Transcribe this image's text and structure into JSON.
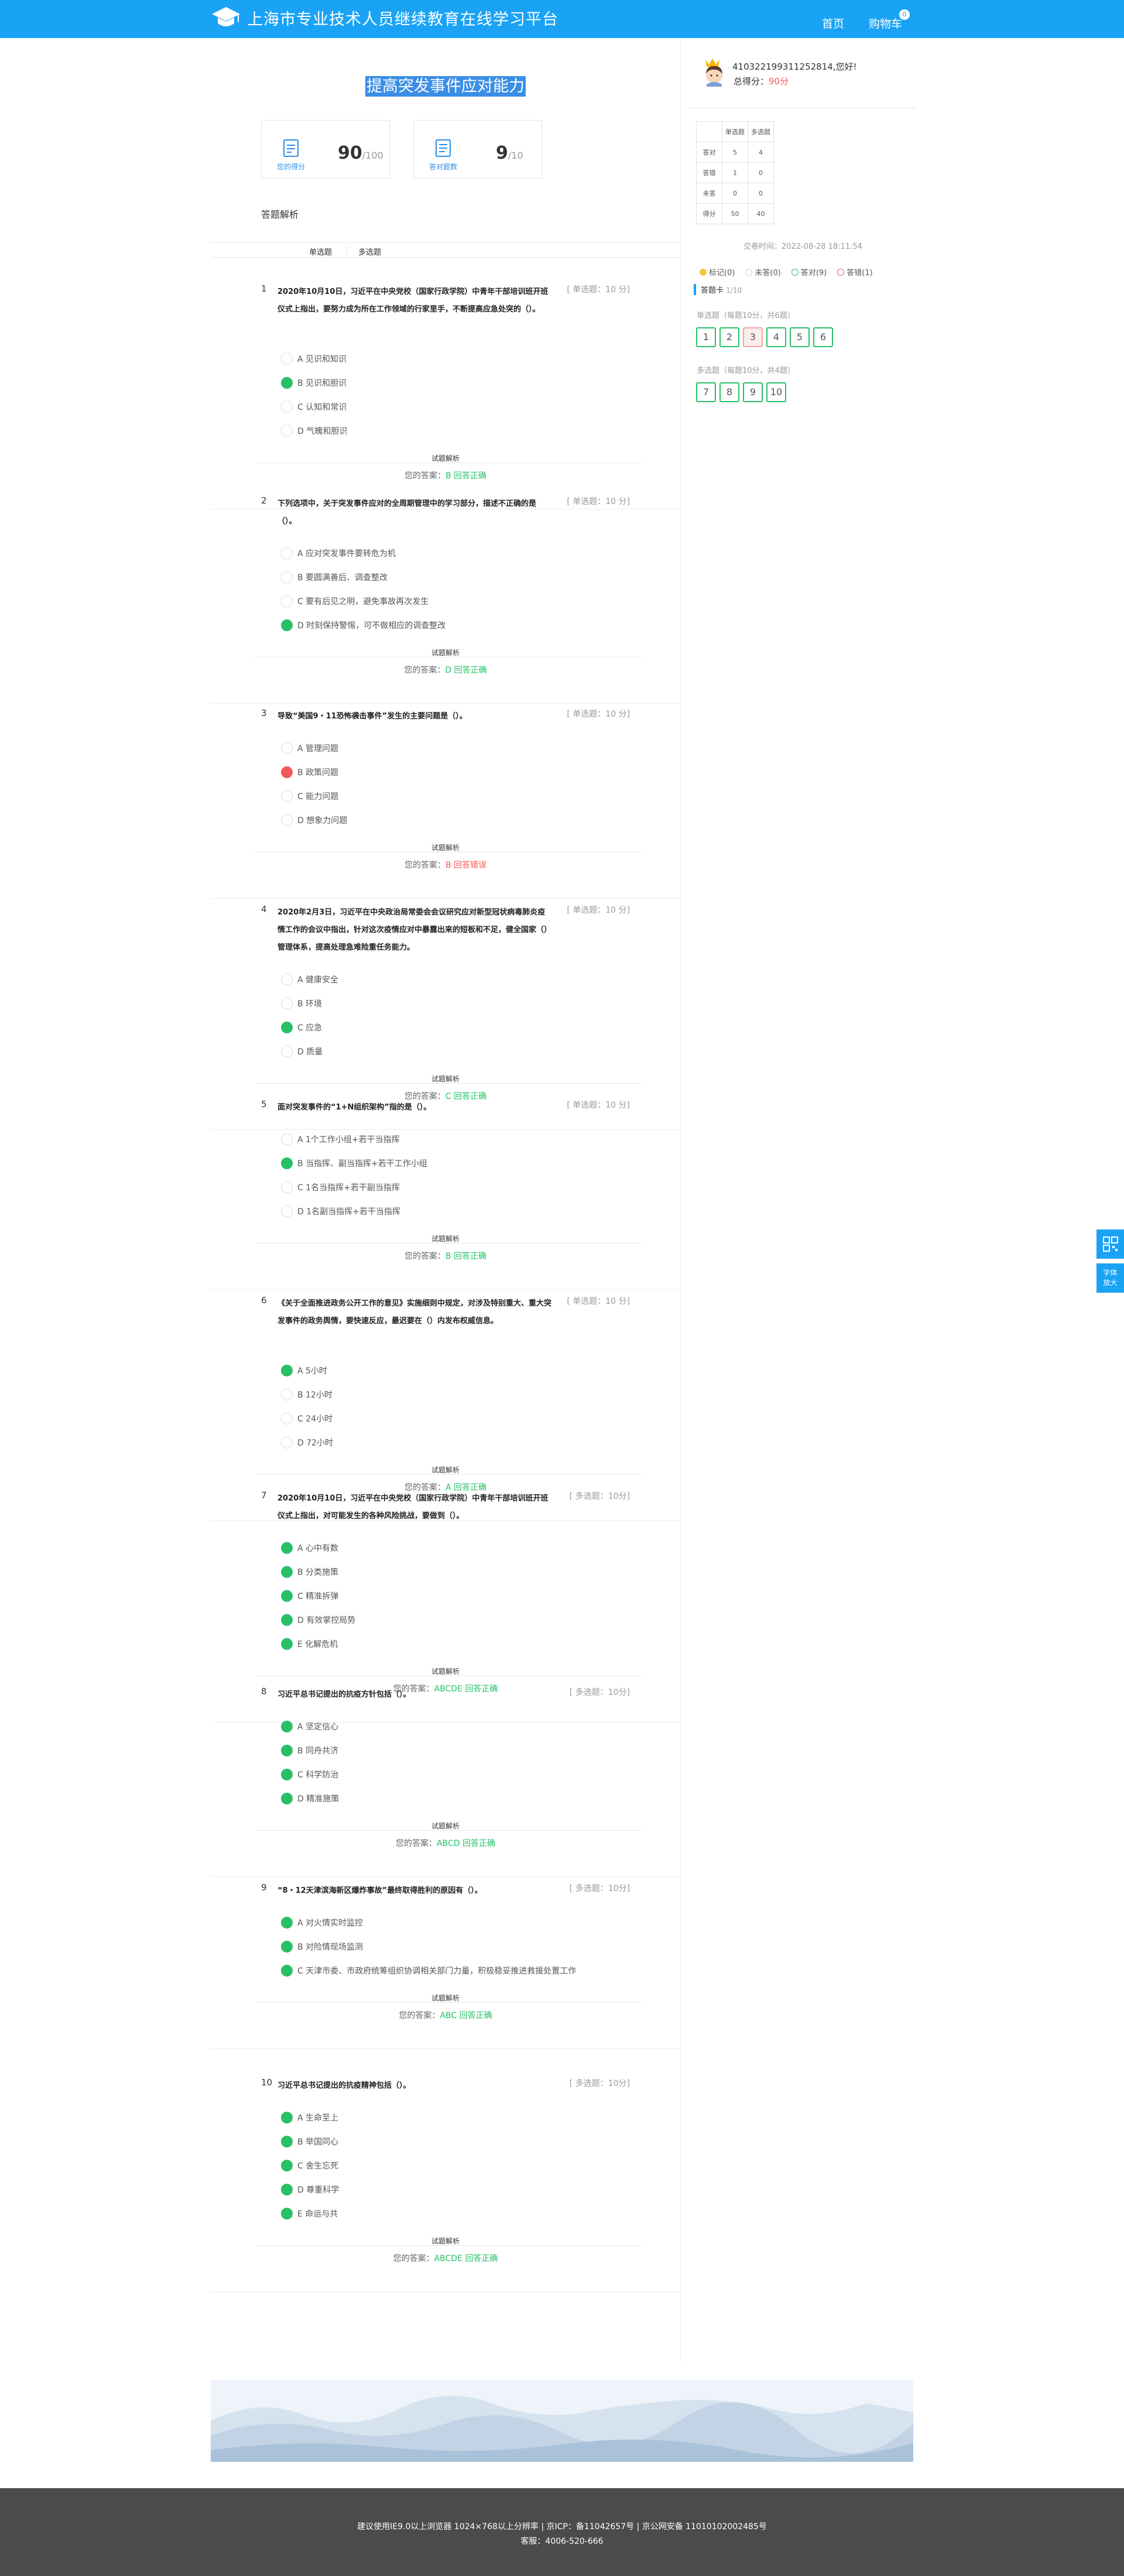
{
  "header": {
    "site_title": "上海市专业技术人员继续教育在线学习平台",
    "nav_home": "首页",
    "nav_cart": "购物车",
    "cart_count": "0"
  },
  "exam": {
    "title": "提高突发事件应对能力",
    "my_score_label": "您的得分",
    "my_score": "90",
    "my_score_total": "/100",
    "correct_label": "答对题数",
    "correct_count": "9",
    "correct_total": "/10",
    "analysis_title": "答题解析",
    "tab_single": "单选题",
    "tab_multi": "多选题"
  },
  "questions": [
    {
      "num": "1",
      "text": "2020年10月10日，习近平在中央党校（国家行政学院）中青年干部培训班开班仪式上指出，要努力成为所在工作领域的行家里手，不断提高应急处突的（）。",
      "meta": "[ 单选题：10 分]",
      "options": [
        {
          "label": "A 见识和知识",
          "state": "none"
        },
        {
          "label": "B 见识和胆识",
          "state": "correct"
        },
        {
          "label": "C 认知和常识",
          "state": "none"
        },
        {
          "label": "D 气魄和胆识",
          "state": "none"
        }
      ],
      "expl": "试题解析",
      "answer_prefix": "您的答案：",
      "answer": "B",
      "result": "回答正确",
      "ok": true
    },
    {
      "num": "2",
      "text": "下列选项中，关于突发事件应对的全周期管理中的学习部分，描述不正确的是（）。",
      "meta": "[ 单选题：10 分]",
      "options": [
        {
          "label": "A 应对突发事件要转危为机",
          "state": "none"
        },
        {
          "label": "B 要圆满善后、调查整改",
          "state": "none"
        },
        {
          "label": "C 要有后见之明，避免事故再次发生",
          "state": "none"
        },
        {
          "label": "D 时刻保持警惕，可不做相应的调查整改",
          "state": "correct"
        }
      ],
      "expl": "试题解析",
      "answer_prefix": "您的答案：",
      "answer": "D",
      "result": "回答正确",
      "ok": true
    },
    {
      "num": "3",
      "text": "导致“美国9・11恐怖袭击事件”发生的主要问题是（）。",
      "meta": "[ 单选题：10 分]",
      "options": [
        {
          "label": "A 管理问题",
          "state": "none"
        },
        {
          "label": "B 政策问题",
          "state": "wrong"
        },
        {
          "label": "C 能力问题",
          "state": "none"
        },
        {
          "label": "D 想象力问题",
          "state": "none"
        }
      ],
      "expl": "试题解析",
      "answer_prefix": "您的答案：",
      "answer": "B",
      "result": "回答错误",
      "ok": false
    },
    {
      "num": "4",
      "text": "2020年2月3日，习近平在中央政治局常委会会议研究应对新型冠状病毒肺炎疫情工作的会议中指出，针对这次疫情应对中暴露出来的短板和不足，健全国家（）管理体系，提高处理急难险重任务能力。",
      "meta": "[ 单选题：10 分]",
      "options": [
        {
          "label": "A 健康安全",
          "state": "none"
        },
        {
          "label": "B 环境",
          "state": "none"
        },
        {
          "label": "C 应急",
          "state": "correct"
        },
        {
          "label": "D 质量",
          "state": "none"
        }
      ],
      "expl": "试题解析",
      "answer_prefix": "您的答案：",
      "answer": "C",
      "result": "回答正确",
      "ok": true
    },
    {
      "num": "5",
      "text": "面对突发事件的“1+N组织架构”指的是（）。",
      "meta": "[ 单选题：10 分]",
      "options": [
        {
          "label": "A 1个工作小组+若干当指挥",
          "state": "none"
        },
        {
          "label": "B 当指挥、副当指挥+若干工作小组",
          "state": "correct"
        },
        {
          "label": "C 1名当指挥+若干副当指挥",
          "state": "none"
        },
        {
          "label": "D 1名副当指挥+若干当指挥",
          "state": "none"
        }
      ],
      "expl": "试题解析",
      "answer_prefix": "您的答案：",
      "answer": "B",
      "result": "回答正确",
      "ok": true
    },
    {
      "num": "6",
      "text": "《关于全面推进政务公开工作的意见》实施细则中规定，对涉及特别重大、重大突发事件的政务舆情，要快速反应，最迟要在（）内发布权威信息。",
      "meta": "[ 单选题：10 分]",
      "options": [
        {
          "label": "A 5小时",
          "state": "correct"
        },
        {
          "label": "B 12小时",
          "state": "none"
        },
        {
          "label": "C 24小时",
          "state": "none"
        },
        {
          "label": "D 72小时",
          "state": "none"
        }
      ],
      "expl": "试题解析",
      "answer_prefix": "您的答案：",
      "answer": "A",
      "result": "回答正确",
      "ok": true
    },
    {
      "num": "7",
      "text": "2020年10月10日，习近平在中央党校（国家行政学院）中青年干部培训班开班仪式上指出，对可能发生的各种风险挑战，要做到（）。",
      "meta": "[ 多选题：10分]",
      "options": [
        {
          "label": "A 心中有数",
          "state": "correct"
        },
        {
          "label": "B 分类施策",
          "state": "correct"
        },
        {
          "label": "C 精准拆弹",
          "state": "correct"
        },
        {
          "label": "D 有效掌控局势",
          "state": "correct"
        },
        {
          "label": "E 化解危机",
          "state": "correct"
        }
      ],
      "expl": "试题解析",
      "answer_prefix": "您的答案：",
      "answer": "ABCDE",
      "result": "回答正确",
      "ok": true
    },
    {
      "num": "8",
      "text": "习近平总书记提出的抗疫方针包括（）。",
      "meta": "[ 多选题：10分]",
      "options": [
        {
          "label": "A 坚定信心",
          "state": "correct"
        },
        {
          "label": "B 同舟共济",
          "state": "correct"
        },
        {
          "label": "C 科学防治",
          "state": "correct"
        },
        {
          "label": "D 精准施策",
          "state": "correct"
        }
      ],
      "expl": "试题解析",
      "answer_prefix": "您的答案：",
      "answer": "ABCD",
      "result": "回答正确",
      "ok": true
    },
    {
      "num": "9",
      "text": "“8・12天津滨海新区爆炸事故”最终取得胜利的原因有（）。",
      "meta": "[ 多选题：10分]",
      "options": [
        {
          "label": "A 对火情实时监控",
          "state": "correct"
        },
        {
          "label": "B 对险情现场监测",
          "state": "correct"
        },
        {
          "label": "C 天津市委、市政府统筹组织协调相关部门力量，积极稳妥推进救援处置工作",
          "state": "correct"
        }
      ],
      "expl": "试题解析",
      "answer_prefix": "您的答案：",
      "answer": "ABC",
      "result": "回答正确",
      "ok": true
    },
    {
      "num": "10",
      "text": "习近平总书记提出的抗疫精神包括（）。",
      "meta": "[ 多选题：10分]",
      "options": [
        {
          "label": "A 生命至上",
          "state": "correct"
        },
        {
          "label": "B 举国同心",
          "state": "correct"
        },
        {
          "label": "C 舍生忘死",
          "state": "correct"
        },
        {
          "label": "D 尊重科学",
          "state": "correct"
        },
        {
          "label": "E 命运与共",
          "state": "correct"
        }
      ],
      "expl": "试题解析",
      "answer_prefix": "您的答案：",
      "answer": "ABCDE",
      "result": "回答正确",
      "ok": true
    }
  ],
  "sidebar": {
    "user_id": "410322199311252814,您好!",
    "total_label": "总得分：",
    "total_value": "90分",
    "table": {
      "headers": [
        "",
        "单选题",
        "多选题"
      ],
      "rows": [
        [
          "答对",
          "5",
          "4"
        ],
        [
          "答错",
          "1",
          "0"
        ],
        [
          "未答",
          "0",
          "0"
        ],
        [
          "得分",
          "50",
          "40"
        ]
      ]
    },
    "submit_time": "交卷时间：2022-08-28 18:11:54",
    "legend": [
      {
        "label": "标记(0)",
        "color": "#f5c542"
      },
      {
        "label": "未答(0)",
        "color": "#ffffff"
      },
      {
        "label": "答对(9)",
        "color": "#ffffff"
      },
      {
        "label": "答错(1)",
        "color": "#ffffff"
      }
    ],
    "card_title": "答题卡",
    "card_count": "1/10",
    "single_section": "单选题（每题10分，共6题）",
    "multi_section": "多选题（每题10分，共4题）",
    "single_numbers": [
      "1",
      "2",
      "3",
      "4",
      "5",
      "6"
    ],
    "multi_numbers": [
      "7",
      "8",
      "9",
      "10"
    ],
    "wrong_numbers": [
      "3"
    ]
  },
  "float": {
    "qr_label": "",
    "font_label": "字体放大"
  },
  "footer": {
    "line1": "建议使用IE9.0以上浏览器 1024×768以上分辨率 | 京ICP：备11042657号 | 京公网安备 11010102002485号",
    "line2": "客服：4006-520-666"
  }
}
